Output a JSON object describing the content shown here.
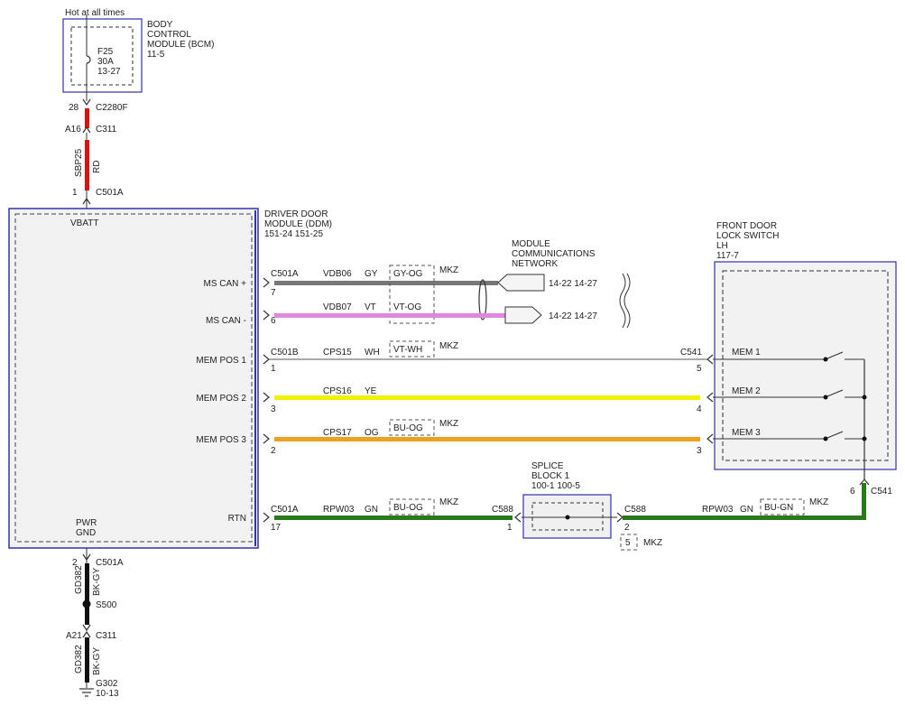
{
  "bcm": {
    "hot_label": "Hot at all times",
    "name_l1": "BODY",
    "name_l2": "CONTROL",
    "name_l3": "MODULE (BCM)",
    "ref": "11-5",
    "fuse_id": "F25",
    "fuse_rating": "30A",
    "fuse_ref": "13-27"
  },
  "feed": {
    "c1_pin": "28",
    "c1_id": "C2280F",
    "c2_pin": "A16",
    "c2_id": "C311",
    "circuit": "SBP25",
    "color": "RD",
    "c3_pin": "1",
    "c3_id": "C501A"
  },
  "ddm": {
    "name_l1": "DRIVER DOOR",
    "name_l2": "MODULE (DDM)",
    "refs": "151-24  151-25",
    "vbatt": "VBATT",
    "pwr": "PWR",
    "gnd": "GND",
    "pins": {
      "ms_can_plus": "MS CAN +",
      "ms_can_minus": "MS CAN -",
      "mem1": "MEM POS 1",
      "mem2": "MEM POS 2",
      "mem3": "MEM POS 3",
      "rtn": "RTN"
    }
  },
  "wires": {
    "can_plus": {
      "conn": "C501A",
      "pin": "7",
      "circuit": "VDB06",
      "color": "GY",
      "alt": "GY-OG",
      "mkz": "MKZ",
      "dest": "14-22   14-27"
    },
    "can_minus": {
      "pin": "6",
      "circuit": "VDB07",
      "color": "VT",
      "alt": "VT-OG",
      "dest": "14-22   14-27"
    },
    "mem1": {
      "conn": "C501B",
      "pin": "1",
      "circuit": "CPS15",
      "color": "WH",
      "alt": "VT-WH",
      "mkz": "MKZ",
      "far_conn": "C541",
      "far_pin": "5"
    },
    "mem2": {
      "pin": "3",
      "circuit": "CPS16",
      "color": "YE",
      "far_pin": "4"
    },
    "mem3": {
      "pin": "2",
      "circuit": "CPS17",
      "color": "OG",
      "alt": "BU-OG",
      "mkz": "MKZ",
      "far_pin": "3"
    },
    "rtn": {
      "conn": "C501A",
      "pin": "17",
      "circuit": "RPW03",
      "color": "GN",
      "alt": "BU-OG",
      "mkz": "MKZ",
      "splice_in_conn": "C588",
      "splice_in_pin": "1",
      "splice_out_conn": "C588",
      "splice_out_pin": "2",
      "circuit2": "RPW03",
      "color2": "GN",
      "alt2": "BU-GN",
      "mkz2": "MKZ",
      "far_pin": "6",
      "far_conn": "C541",
      "mkz_pin": "5",
      "mkz_pin_label": "MKZ"
    }
  },
  "network": {
    "l1": "MODULE",
    "l2": "COMMUNICATIONS",
    "l3": "NETWORK"
  },
  "splice": {
    "l1": "SPLICE",
    "l2": "BLOCK 1",
    "refs": "100-1   100-5"
  },
  "switch": {
    "l1": "FRONT DOOR",
    "l2": "LOCK SWITCH",
    "l3": "LH",
    "ref": "117-7",
    "mem1": "MEM 1",
    "mem2": "MEM 2",
    "mem3": "MEM 3"
  },
  "ground": {
    "c1_pin": "2",
    "c1_id": "C501A",
    "circuit": "GD382",
    "color": "BK-GY",
    "splice_id": "S500",
    "c2_pin": "A21",
    "c2_id": "C311",
    "circuit2": "GD382",
    "color2": "BK-GY",
    "g_id": "G302",
    "g_ref": "10-13"
  },
  "colors": {
    "frame": "#3333aa",
    "red": "#dd1111",
    "gray": "#777777",
    "violet": "#dd88dd",
    "yellow": "#f0f000",
    "orange": "#f0a020",
    "green": "#2a7a1a",
    "black": "#111111"
  }
}
